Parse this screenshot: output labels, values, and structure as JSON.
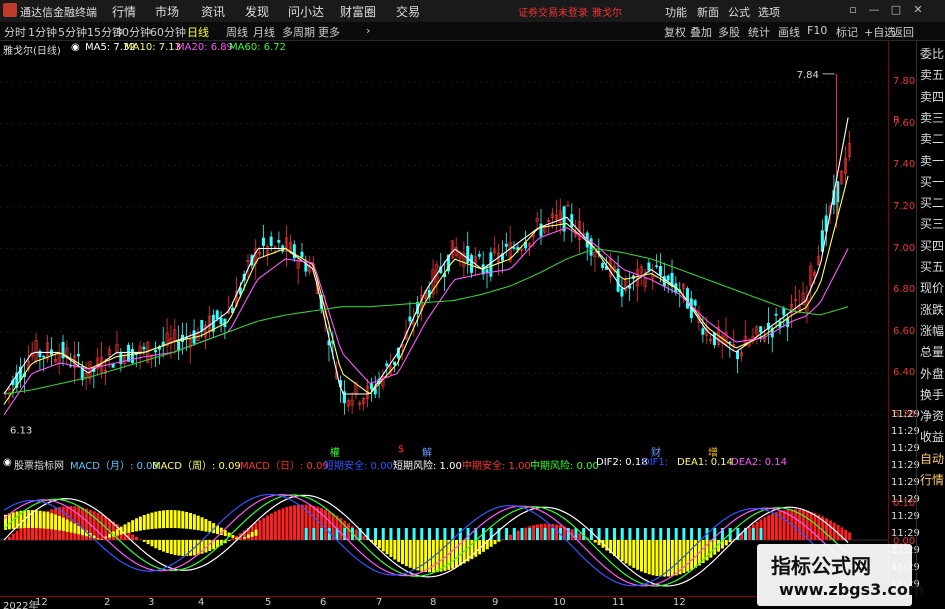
{
  "app": {
    "name": "通达信金融终端"
  },
  "menu": [
    "行情",
    "市场",
    "资讯",
    "发现",
    "问小达",
    "财富圈",
    "交易"
  ],
  "warning": "证券交易未登录",
  "stock_name_top": "雅戈尔",
  "top_right": [
    "功能",
    "新面",
    "公式",
    "选项"
  ],
  "periods": [
    "分时",
    "1分钟",
    "5分钟",
    "15分钟",
    "30分钟",
    "60分钟",
    "日线",
    "周线",
    "月线",
    "多周期",
    "更多"
  ],
  "active_period": "日线",
  "tools": [
    "复权",
    "叠加",
    "多股",
    "统计",
    "画线",
    "F10",
    "标记",
    "+自选",
    "返回"
  ],
  "chart_title": "雅戈尔(日线)",
  "ma": {
    "ma5": "MA5: 7.32",
    "ma10": "MA10: 7.13",
    "ma20": "MA20: 6.89",
    "ma60": "MA60: 6.72"
  },
  "indicator": {
    "name": "股票指标网",
    "items": [
      {
        "t": "MACD（月）: 0.03",
        "c": "#5ac8ff"
      },
      {
        "t": "MACD（周）: 0.09",
        "c": "#ffff66"
      },
      {
        "t": "MACD（日）: 0.09",
        "c": "#ff3333"
      },
      {
        "t": "短期安全: 0.00",
        "c": "#3355ff"
      },
      {
        "t": "短期风险: 1.00",
        "c": "#ffffff"
      },
      {
        "t": "中期安全: 1.00",
        "c": "#ff3333"
      },
      {
        "t": "中期风险: 0.00",
        "c": "#33ff33"
      },
      {
        "t": "DIF2: 0.18",
        "c": "#ffffff"
      },
      {
        "t": "DIF1:",
        "c": "#3355ff"
      },
      {
        "t": "DEA1: 0.14",
        "c": "#ffff66"
      },
      {
        "t": "DEA2: 0.14",
        "c": "#ff55ff"
      }
    ]
  },
  "price_labels": [
    "7.80",
    "7.60",
    "7.40",
    "7.20",
    "7.00",
    "6.80",
    "6.60",
    "6.40",
    "6.20"
  ],
  "price_marks": {
    "high": "7.84",
    "low": "6.13"
  },
  "ind_labels": [
    "0.10",
    "0.00"
  ],
  "right_panel": [
    "委比",
    "卖五",
    "卖四",
    "卖三",
    "卖二",
    "卖一",
    "买一",
    "买二",
    "买三",
    "买四",
    "买五",
    "现价",
    "涨跌",
    "涨幅",
    "总量",
    "外盘",
    "换手",
    "净资",
    "收益",
    "自动",
    "行情"
  ],
  "time_labels": [
    "11:29",
    "11:29",
    "11:29",
    "11:29",
    "11:29",
    "11:29",
    "11:29",
    "11:29",
    "11:29",
    "11:29",
    "11:29"
  ],
  "x_labels": [
    "2022年",
    "12",
    "2",
    "3",
    "4",
    "5",
    "6",
    "7",
    "8",
    "9",
    "10",
    "11",
    "12"
  ],
  "events": [
    {
      "t": "權",
      "c": "#33ff33"
    },
    {
      "t": "$",
      "c": "#ff3333"
    },
    {
      "t": "解",
      "c": "#6699ff"
    },
    {
      "t": "财",
      "c": "#6699ff"
    },
    {
      "t": "增",
      "c": "#ffcc00"
    }
  ],
  "watermark": {
    "line1": "指标公式网",
    "line2": "www.zbgs3.com"
  },
  "chart_data": {
    "type": "line",
    "title": "雅戈尔(日线)",
    "ylim": [
      6.13,
      7.84
    ],
    "series": [
      {
        "name": "MA5",
        "values": [
          6.3,
          6.5,
          6.5,
          6.4,
          6.5,
          6.5,
          6.55,
          6.6,
          6.7,
          7.0,
          7.0,
          6.9,
          6.3,
          6.3,
          6.5,
          6.8,
          7.0,
          6.9,
          7.0,
          7.1,
          7.15,
          7.0,
          6.8,
          6.9,
          6.8,
          6.6,
          6.5,
          6.6,
          6.7,
          6.8,
          7.3
        ]
      },
      {
        "name": "MA10",
        "values": [
          6.25,
          6.45,
          6.5,
          6.42,
          6.48,
          6.5,
          6.55,
          6.58,
          6.65,
          6.95,
          7.0,
          6.92,
          6.4,
          6.3,
          6.45,
          6.75,
          6.95,
          6.9,
          6.95,
          7.1,
          7.12,
          7.0,
          6.85,
          6.88,
          6.8,
          6.62,
          6.52,
          6.58,
          6.68,
          6.75,
          7.13
        ]
      },
      {
        "name": "MA20",
        "values": [
          6.2,
          6.4,
          6.45,
          6.42,
          6.45,
          6.48,
          6.5,
          6.55,
          6.6,
          6.85,
          6.95,
          6.93,
          6.5,
          6.35,
          6.4,
          6.65,
          6.85,
          6.88,
          6.9,
          7.05,
          7.1,
          7.02,
          6.9,
          6.85,
          6.78,
          6.65,
          6.55,
          6.57,
          6.65,
          6.7,
          6.89
        ]
      },
      {
        "name": "MA60",
        "values": [
          6.3,
          6.32,
          6.35,
          6.38,
          6.42,
          6.46,
          6.5,
          6.55,
          6.6,
          6.65,
          6.68,
          6.7,
          6.72,
          6.72,
          6.73,
          6.74,
          6.75,
          6.78,
          6.82,
          6.88,
          6.95,
          7.0,
          6.98,
          6.95,
          6.9,
          6.85,
          6.8,
          6.75,
          6.7,
          6.68,
          6.72
        ]
      }
    ]
  }
}
